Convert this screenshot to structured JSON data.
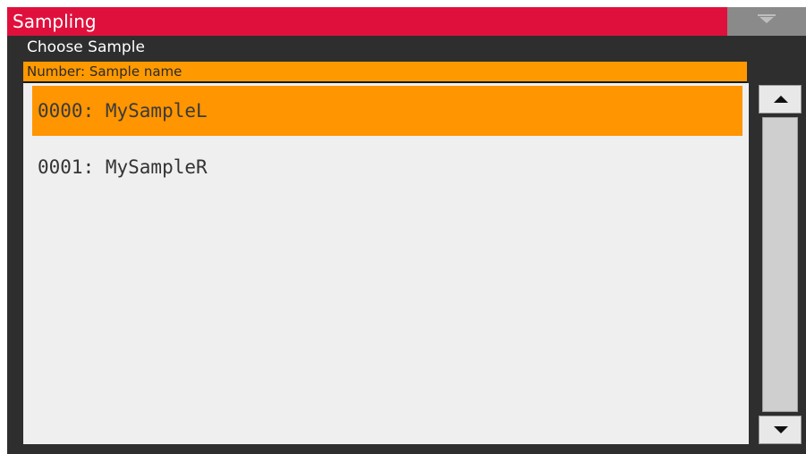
{
  "window": {
    "title": "Sampling",
    "menu_icon": "chevron-down-icon"
  },
  "panel": {
    "subtitle": "Choose Sample",
    "column_header": "Number: Sample name"
  },
  "samples": [
    {
      "label": "0000: MySampleL",
      "selected": true
    },
    {
      "label": "0001: MySampleR",
      "selected": false
    }
  ],
  "scrollbar": {
    "up_icon": "arrow-up-icon",
    "down_icon": "arrow-down-icon"
  },
  "colors": {
    "title_bar": "#e0103c",
    "accent": "#ff9900",
    "background": "#2e2e2e",
    "list_background": "#efefef"
  }
}
